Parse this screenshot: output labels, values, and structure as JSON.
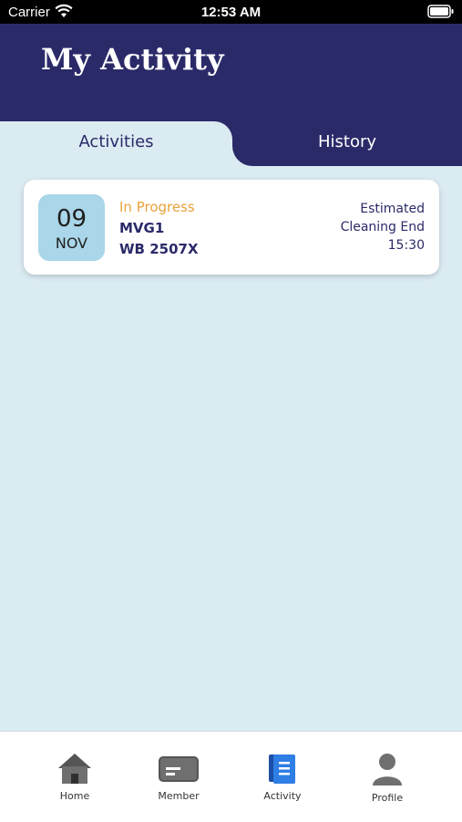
{
  "status_bar": {
    "carrier": "Carrier",
    "time": "12:53 AM"
  },
  "header": {
    "title": "My Activity"
  },
  "tabs": [
    {
      "label": "Activities",
      "active": true
    },
    {
      "label": "History",
      "active": false
    }
  ],
  "activity_card": {
    "day": "09",
    "month": "NOV",
    "status": "In Progress",
    "line1": "MVG1",
    "line2": "WB 2507X",
    "estimate_line1": "Estimated",
    "estimate_line2": "Cleaning End",
    "estimate_time": "15:30"
  },
  "bottom_nav": [
    {
      "label": "Home",
      "icon": "home-icon",
      "active": false
    },
    {
      "label": "Member",
      "icon": "member-card-icon",
      "active": false
    },
    {
      "label": "Activity",
      "icon": "activity-icon",
      "active": true
    },
    {
      "label": "Profile",
      "icon": "profile-icon",
      "active": false
    }
  ],
  "colors": {
    "header_bg": "#2b2a69",
    "page_bg": "#dbebf2",
    "status_orange": "#e8a23a",
    "active_blue": "#2f7ee6"
  }
}
